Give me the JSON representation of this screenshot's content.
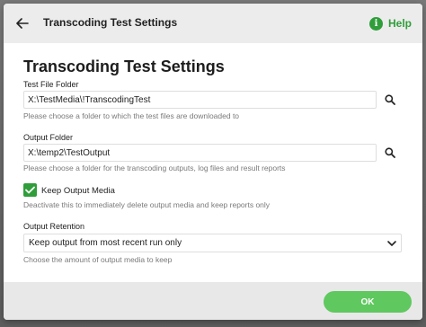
{
  "header": {
    "title": "Transcoding Test Settings",
    "help_label": "Help",
    "help_glyph": "i"
  },
  "page_title": "Transcoding Test Settings",
  "fields": {
    "test_folder": {
      "label": "Test File Folder",
      "value": "X:\\TestMedia\\!TranscodingTest",
      "helper": "Please choose a folder to which the test files are downloaded to"
    },
    "output_folder": {
      "label": "Output Folder",
      "value": "X:\\temp2\\TestOutput",
      "helper": "Please choose a folder for the transcoding outputs, log files and result reports"
    },
    "keep_output": {
      "label": "Keep Output Media",
      "checked": true,
      "helper": "Deactivate this to immediately delete output media and keep reports only"
    },
    "retention": {
      "label": "Output Retention",
      "selected": "Keep output from most recent run only",
      "helper": "Choose the amount of output media to keep"
    }
  },
  "footer": {
    "ok_label": "OK"
  },
  "colors": {
    "accent_green": "#2f9e3a",
    "ok_button": "#5fc85f",
    "header_bg": "#ececec"
  },
  "icons": [
    "back-arrow-icon",
    "help-info-icon",
    "search-icon",
    "checkmark-icon",
    "chevron-down-icon"
  ]
}
